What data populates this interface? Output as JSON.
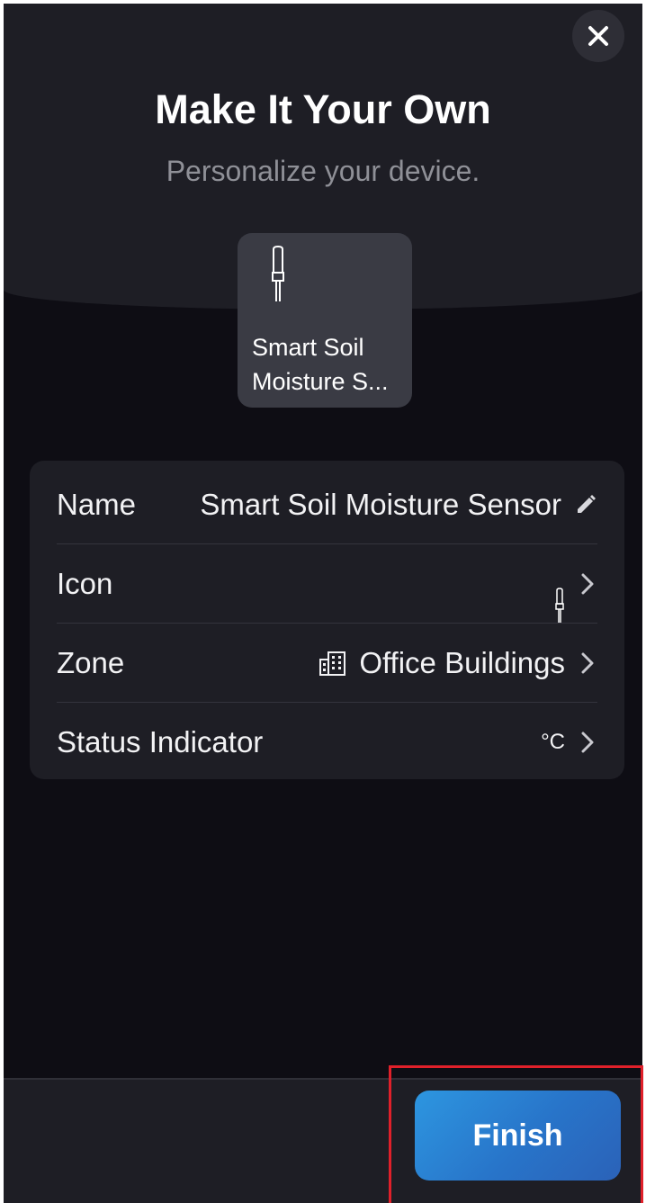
{
  "header": {
    "title": "Make It Your Own",
    "subtitle": "Personalize your device.",
    "close_icon": "close-icon"
  },
  "device_card": {
    "icon": "soil-probe-icon",
    "name": "Smart Soil Moisture S..."
  },
  "settings": {
    "name": {
      "label": "Name",
      "value": "Smart Soil Moisture Sensor",
      "icon": "pencil-icon"
    },
    "icon": {
      "label": "Icon",
      "value_icon": "soil-probe-icon"
    },
    "zone": {
      "label": "Zone",
      "value": "Office Buildings",
      "icon": "building-icon"
    },
    "status_indicator": {
      "label": "Status Indicator",
      "value": "°C"
    }
  },
  "footer": {
    "finish_label": "Finish"
  },
  "colors": {
    "background": "#0e0d14",
    "panel": "#1e1e25",
    "card": "#3a3b44",
    "accent": "#2b7fd4",
    "highlight": "#e0202a"
  }
}
